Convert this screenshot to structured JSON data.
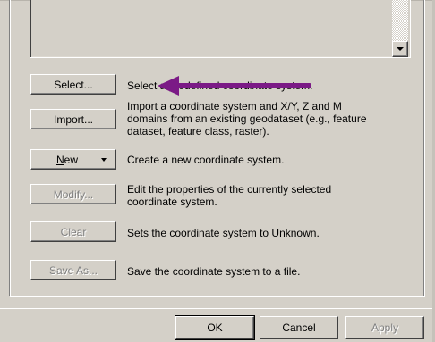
{
  "buttons": {
    "select": "Select...",
    "import": "Import...",
    "new_prefix": "N",
    "new_rest": "ew",
    "modify": "Modify...",
    "clear": "Clear",
    "save_as": "Save As..."
  },
  "descriptions": {
    "select": "Select a predefined coordinate system.",
    "import": "Import a coordinate system and X/Y, Z and M domains from an existing geodataset (e.g., feature dataset, feature class, raster).",
    "new": "Create a new coordinate system.",
    "modify": "Edit the properties of the currently selected coordinate system.",
    "clear": "Sets the coordinate system to Unknown.",
    "save_as": "Save the coordinate system to a file."
  },
  "dialog_buttons": {
    "ok": "OK",
    "cancel": "Cancel",
    "apply": "Apply"
  },
  "annotation": {
    "color": "#7b1a86"
  }
}
